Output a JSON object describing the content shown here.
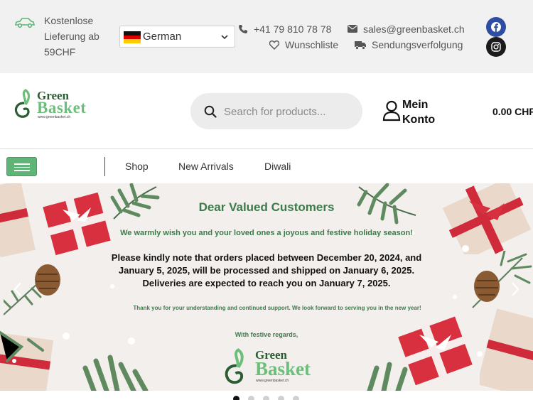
{
  "topbar": {
    "shipping_text": "Kostenlose Lieferung ab 59CHF",
    "language": "German",
    "phone": "+41 79 810 78 78",
    "email": "sales@greenbasket.ch",
    "wishlist": "Wunschliste",
    "tracking": "Sendungsverfolgung",
    "social": [
      "facebook-icon",
      "instagram-icon"
    ]
  },
  "header": {
    "logo_line1": "Green",
    "logo_line2": "Basket",
    "logo_url": "www.greenbasket.ch",
    "search_placeholder": "Search for products...",
    "account_line1": "Mein",
    "account_line2": "Konto",
    "cart_total": "0.00 CHF"
  },
  "nav": {
    "items": [
      "Shop",
      "New Arrivals",
      "Diwali"
    ]
  },
  "banner": {
    "title": "Dear Valued Customers",
    "wish": "We warmly wish you and your loved ones a joyous and festive holiday season!",
    "notice": "Please kindly note that orders placed between December 20, 2024, and January 5, 2025, will be processed and shipped on January 6, 2025. Deliveries are expected to reach you on January 7, 2025.",
    "thanks": "Thank you for your understanding and continued support. We look forward to serving you in the new year!",
    "regards": "With festive regards,",
    "logo_line1": "Green",
    "logo_line2": "Basket",
    "logo_url": "www.greenbasket.ch"
  },
  "slider": {
    "slide_count": 5,
    "active_slide": 1
  },
  "colors": {
    "brand_green": "#5fb577",
    "dark_green": "#3d7a4b",
    "topbar_bg": "#f1f1f1",
    "banner_bg": "#f3efec"
  }
}
